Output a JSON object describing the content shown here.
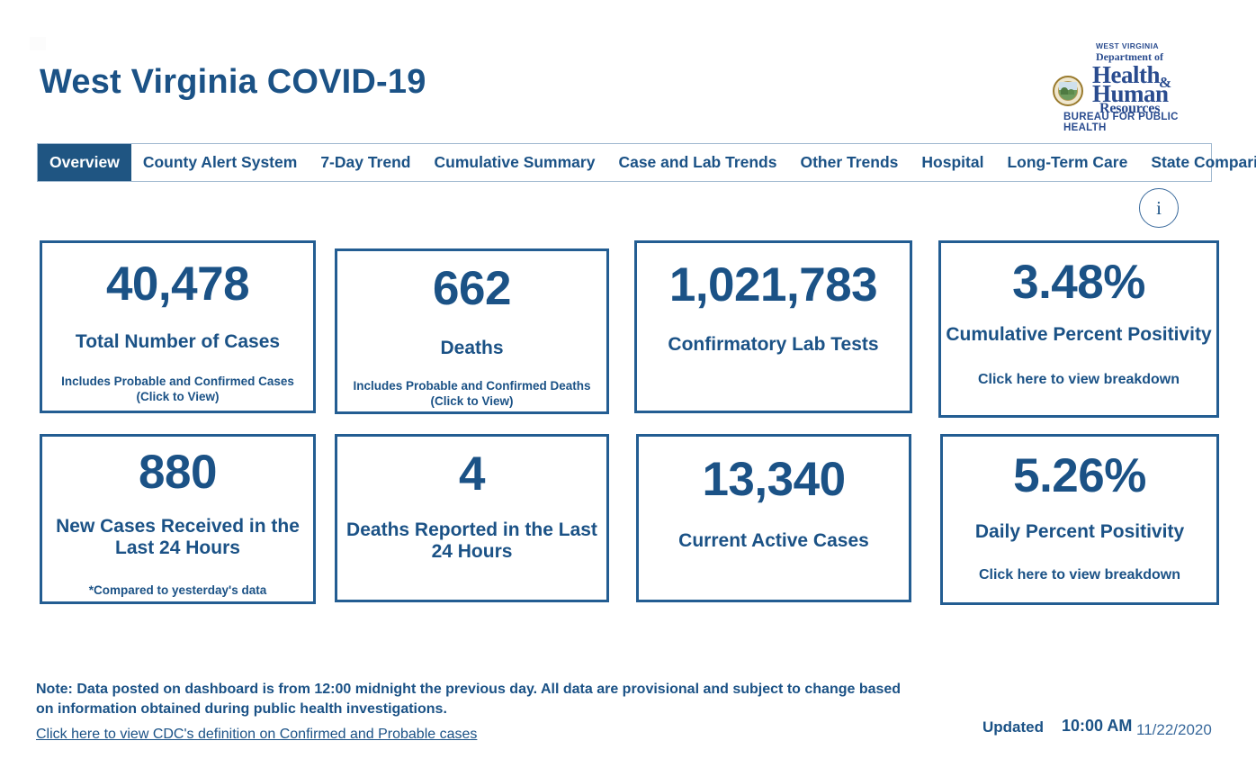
{
  "header": {
    "title": "West Virginia COVID-19",
    "logo": {
      "line1": "WEST VIRGINIA",
      "line2": "Department of",
      "word_health": "Health",
      "ampersand": "&",
      "word_human": "Human",
      "word_resources": "Resources",
      "bureau": "BUREAU FOR PUBLIC HEALTH"
    }
  },
  "nav": {
    "tabs": [
      {
        "label": "Overview",
        "active": true
      },
      {
        "label": "County Alert System",
        "active": false
      },
      {
        "label": "7-Day Trend",
        "active": false
      },
      {
        "label": "Cumulative Summary",
        "active": false
      },
      {
        "label": "Case and Lab Trends",
        "active": false
      },
      {
        "label": "Other Trends",
        "active": false
      },
      {
        "label": "Hospital",
        "active": false
      },
      {
        "label": "Long-Term Care",
        "active": false
      },
      {
        "label": "State Comparison",
        "active": false
      }
    ]
  },
  "info_button": {
    "glyph": "i"
  },
  "cards": [
    {
      "value": "40,478",
      "label": "Total Number of Cases",
      "sub_line1": "Includes Probable and Confirmed Cases",
      "sub_line2": "(Click to View)"
    },
    {
      "value": "662",
      "label": "Deaths",
      "sub_line1": "Includes Probable and Confirmed Deaths",
      "sub_line2": "(Click to View)"
    },
    {
      "value": "1,021,783",
      "label": "Confirmatory Lab Tests"
    },
    {
      "value": "3.48%",
      "label": "Cumulative Percent Positivity",
      "sub_line1": "Click here to view breakdown"
    },
    {
      "value": "880",
      "label": "New Cases Received in the Last 24 Hours",
      "sub_line1": "*Compared to yesterday's data"
    },
    {
      "value": "4",
      "label": "Deaths Reported in the Last 24 Hours"
    },
    {
      "value": "13,340",
      "label": "Current Active Cases"
    },
    {
      "value": "5.26%",
      "label": "Daily Percent Positivity",
      "sub_line1": "Click here to view breakdown"
    }
  ],
  "footer": {
    "note": "Note: Data posted on dashboard is from 12:00 midnight the previous day. All data are provisional and subject to change based on information obtained during public health investigations.",
    "cdc_link": "Click here to view CDC's definition on Confirmed and Probable cases",
    "updated_label": "Updated",
    "updated_time": "10:00 AM",
    "updated_date": "11/22/2020"
  },
  "colors": {
    "primary_blue": "#1b5286",
    "card_border": "#235d92",
    "active_tab_bg": "#1f5582",
    "nav_border": "#9fb8cf",
    "logo_blue": "#2a4c8f"
  }
}
